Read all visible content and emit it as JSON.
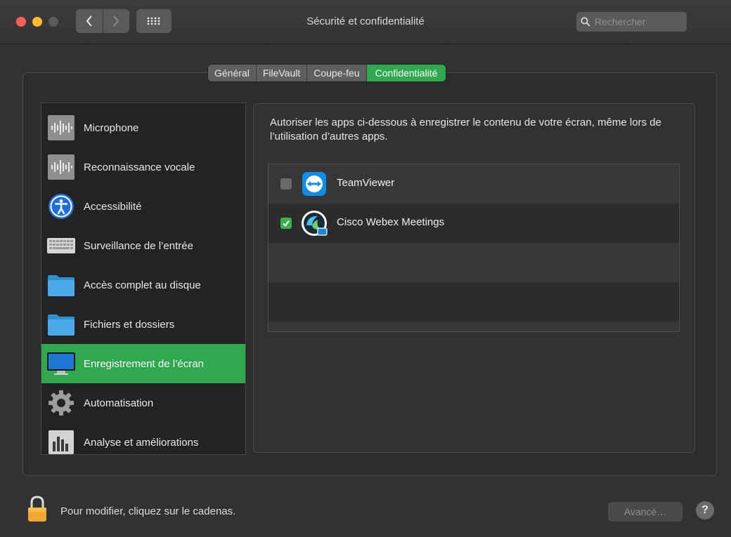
{
  "window": {
    "title": "Sécurité et confidentialité"
  },
  "search": {
    "placeholder": "Rechercher",
    "value": ""
  },
  "tabs": [
    {
      "label": "Général",
      "active": false
    },
    {
      "label": "FileVault",
      "active": false
    },
    {
      "label": "Coupe-feu",
      "active": false
    },
    {
      "label": "Confidentialité",
      "active": true
    }
  ],
  "sidebar": {
    "items": [
      {
        "label": "Microphone",
        "icon": "microphone-waveform-icon"
      },
      {
        "label": "Reconnaissance vocale",
        "icon": "speech-waveform-icon"
      },
      {
        "label": "Accessibilité",
        "icon": "accessibility-icon"
      },
      {
        "label": "Surveillance de l’entrée",
        "icon": "keyboard-icon"
      },
      {
        "label": "Accès complet au disque",
        "icon": "folder-icon"
      },
      {
        "label": "Fichiers et dossiers",
        "icon": "folder-icon"
      },
      {
        "label": "Enregistrement de l’écran",
        "icon": "display-icon",
        "selected": true
      },
      {
        "label": "Automatisation",
        "icon": "gear-icon"
      },
      {
        "label": "Analyse et améliorations",
        "icon": "bar-chart-icon"
      }
    ]
  },
  "main": {
    "description": "Autoriser les apps ci-dessous à enregistrer le contenu de votre écran, même lors de l’utilisation d’autres apps.",
    "apps": [
      {
        "name": "TeamViewer",
        "checked": false,
        "icon": "teamviewer-icon"
      },
      {
        "name": "Cisco Webex Meetings",
        "checked": true,
        "icon": "webex-icon"
      }
    ]
  },
  "footer": {
    "lock_text": "Pour modifier, cliquez sur le cadenas.",
    "advanced_label": "Avancé…",
    "help_label": "?"
  },
  "colors": {
    "accent": "#2fa84f",
    "checkbox_checked": "#35b44a"
  }
}
